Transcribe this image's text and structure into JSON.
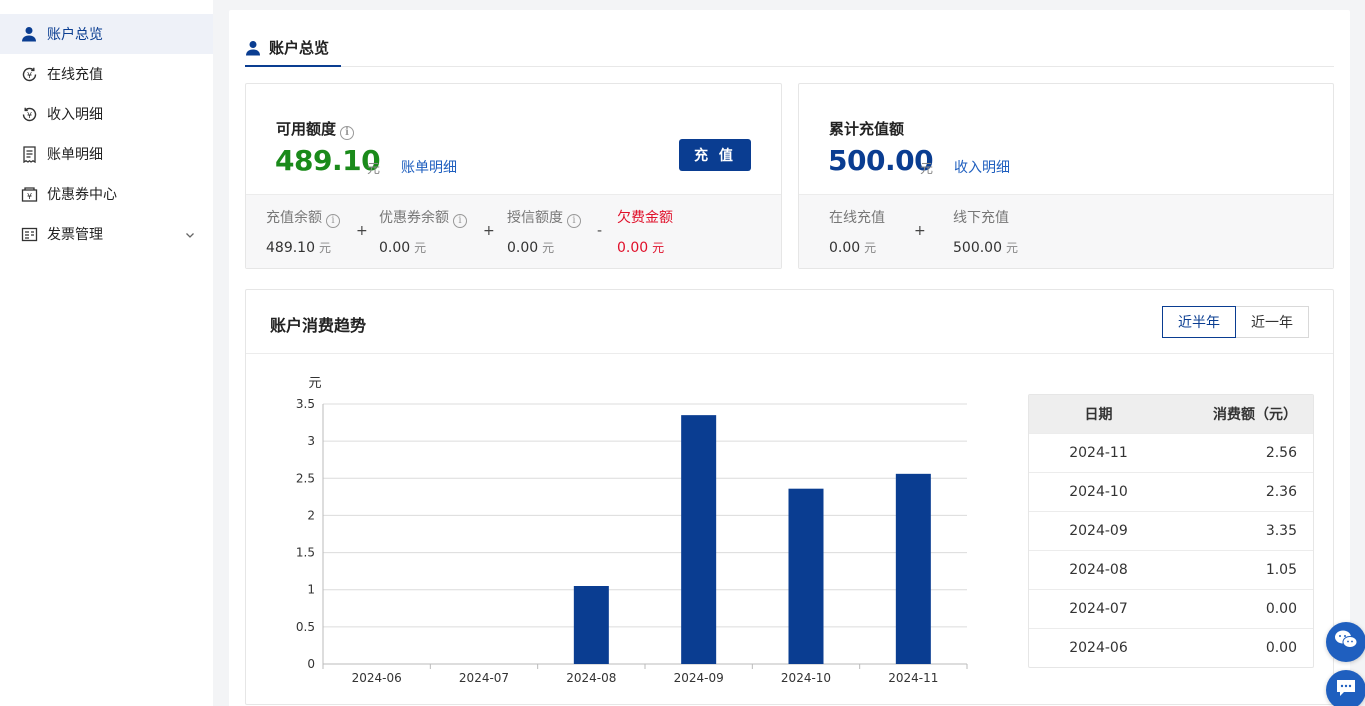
{
  "sidebar": {
    "items": [
      {
        "label": "账户总览",
        "icon": "user-icon",
        "active": true
      },
      {
        "label": "在线充值",
        "icon": "yuan-refresh-icon"
      },
      {
        "label": "收入明细",
        "icon": "yuan-circle-icon"
      },
      {
        "label": "账单明细",
        "icon": "bill-icon"
      },
      {
        "label": "优惠券中心",
        "icon": "coupon-icon"
      },
      {
        "label": "发票管理",
        "icon": "invoice-icon",
        "expandable": true
      }
    ]
  },
  "tab": {
    "label": "账户总览",
    "icon": "user-icon"
  },
  "available": {
    "title": "可用额度",
    "value": "489.10",
    "unit": "元",
    "link": "账单明细",
    "button": "充 值",
    "breakdown": [
      {
        "label": "充值余额",
        "value": "489.10",
        "unit": "元",
        "info": true
      },
      {
        "label": "优惠券余额",
        "value": "0.00",
        "unit": "元",
        "info": true
      },
      {
        "label": "授信额度",
        "value": "0.00",
        "unit": "元",
        "info": true
      },
      {
        "label": "欠费金额",
        "value": "0.00",
        "unit": "元",
        "info": false
      }
    ],
    "operators": [
      "+",
      "+",
      "-"
    ]
  },
  "total": {
    "title": "累计充值额",
    "value": "500.00",
    "unit": "元",
    "link": "收入明细",
    "breakdown": [
      {
        "label": "在线充值",
        "value": "0.00",
        "unit": "元"
      },
      {
        "label": "线下充值",
        "value": "500.00",
        "unit": "元"
      }
    ],
    "operator": "+"
  },
  "trend": {
    "title": "账户消费趋势",
    "ranges": [
      "近半年",
      "近一年"
    ],
    "selected_range": "近半年",
    "table": {
      "headers": [
        "日期",
        "消费额（元）"
      ],
      "rows": [
        [
          "2024-11",
          "2.56"
        ],
        [
          "2024-10",
          "2.36"
        ],
        [
          "2024-09",
          "3.35"
        ],
        [
          "2024-08",
          "1.05"
        ],
        [
          "2024-07",
          "0.00"
        ],
        [
          "2024-06",
          "0.00"
        ]
      ]
    }
  },
  "chart_data": {
    "type": "bar",
    "categories": [
      "2024-06",
      "2024-07",
      "2024-08",
      "2024-09",
      "2024-10",
      "2024-11"
    ],
    "values": [
      0,
      0,
      1.05,
      3.35,
      2.36,
      2.56
    ],
    "ylabel": "元",
    "ylim": [
      0,
      3.5
    ],
    "yticks": [
      "0",
      "0.5",
      "1",
      "1.5",
      "2",
      "2.5",
      "3",
      "3.5"
    ],
    "grid": true,
    "color": "#0a3d91"
  },
  "colors": {
    "primary": "#0a3d91",
    "green": "#1a8a1a",
    "red": "#e0102a",
    "link": "#1f5fbf"
  }
}
